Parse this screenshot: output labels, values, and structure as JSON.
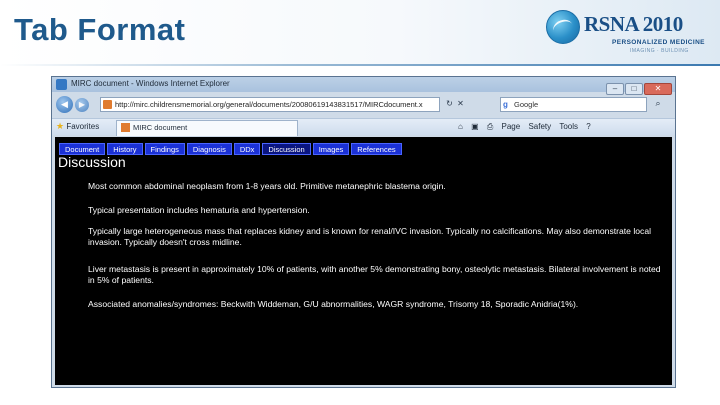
{
  "slide": {
    "title": "Tab Format",
    "logo": {
      "brand": "RSNA 2010",
      "tagline": "PERSONALIZED MEDICINE",
      "subtagline": "IMAGING · BUILDING"
    }
  },
  "browser": {
    "window_title": "MIRC document - Windows Internet Explorer",
    "address": "http://mirc.childrensmemorial.org/general/documents/20080619143831517/MIRCdocument.x",
    "search_placeholder": "Google",
    "favorites_label": "Favorites",
    "tab_title": "MIRC document",
    "tools": {
      "page": "Page",
      "safety": "Safety",
      "tools": "Tools",
      "help": "?"
    }
  },
  "document": {
    "tabs": [
      {
        "label": "Document"
      },
      {
        "label": "History"
      },
      {
        "label": "Findings"
      },
      {
        "label": "Diagnosis"
      },
      {
        "label": "DDx"
      },
      {
        "label": "Discussion"
      },
      {
        "label": "Images"
      },
      {
        "label": "References"
      }
    ],
    "active_tab": "Discussion",
    "heading": "Discussion",
    "paragraphs": [
      "Most common abdominal neoplasm from 1-8 years old. Primitive metanephric blastema origin.",
      "Typical presentation includes hematuria and hypertension.",
      "Typically large heterogeneous mass that replaces kidney and is known for renal/IVC invasion. Typically no calcifications. May also demonstrate local invasion. Typically doesn't cross midline.",
      "Liver metastasis is present in approximately 10% of patients, with another 5% demonstrating bony, osteolytic metastasis. Bilateral involvement is noted in 5% of patients.",
      "Associated anomalies/syndromes: Beckwith Widdeman, G/U abnormalities, WAGR syndrome, Trisomy 18, Sporadic Anidria(1%)."
    ]
  },
  "colors": {
    "title": "#1f5a8c",
    "tab_bg": "#1b31d6",
    "content_bg": "#000000"
  }
}
